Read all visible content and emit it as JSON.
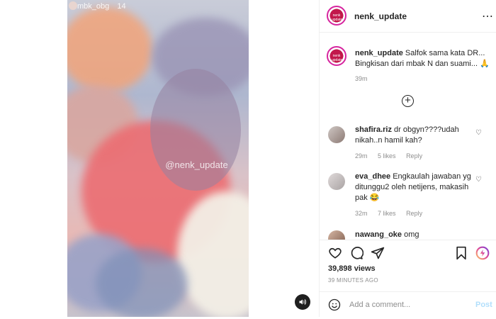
{
  "post": {
    "username": "nenk_update",
    "avatar_text": "nenk update",
    "more_icon": "ellipsis-icon"
  },
  "story_overlay": {
    "username": "mbk_obg",
    "time": "14",
    "watermark": "@nenk_update"
  },
  "caption": {
    "username": "nenk_update",
    "line1": "Salfok sama kata DR...",
    "line2": "Bingkisan dari mbak N dan suami...",
    "emoji": "🙏",
    "time": "39m"
  },
  "comments": [
    {
      "username": "shafira.riz",
      "text": "dr obgyn????udah nikah..n hamil kah?",
      "time": "29m",
      "likes": "5 likes",
      "reply": "Reply"
    },
    {
      "username": "eva_dhee",
      "text": "Engkaulah jawaban yg ditunggu2 oleh netijens, makasih pak 😂",
      "time": "32m",
      "likes": "7 likes",
      "reply": "Reply"
    },
    {
      "username": "nawang_oke",
      "text": "omg"
    }
  ],
  "stats": {
    "views": "39,898 views",
    "time_ago": "39 MINUTES AGO"
  },
  "comment_box": {
    "placeholder": "Add a comment...",
    "post_label": "Post"
  },
  "colors": {
    "accent": "#0095f6",
    "post_disabled": "#b2dffc",
    "meta_grey": "#8e8e8e"
  }
}
